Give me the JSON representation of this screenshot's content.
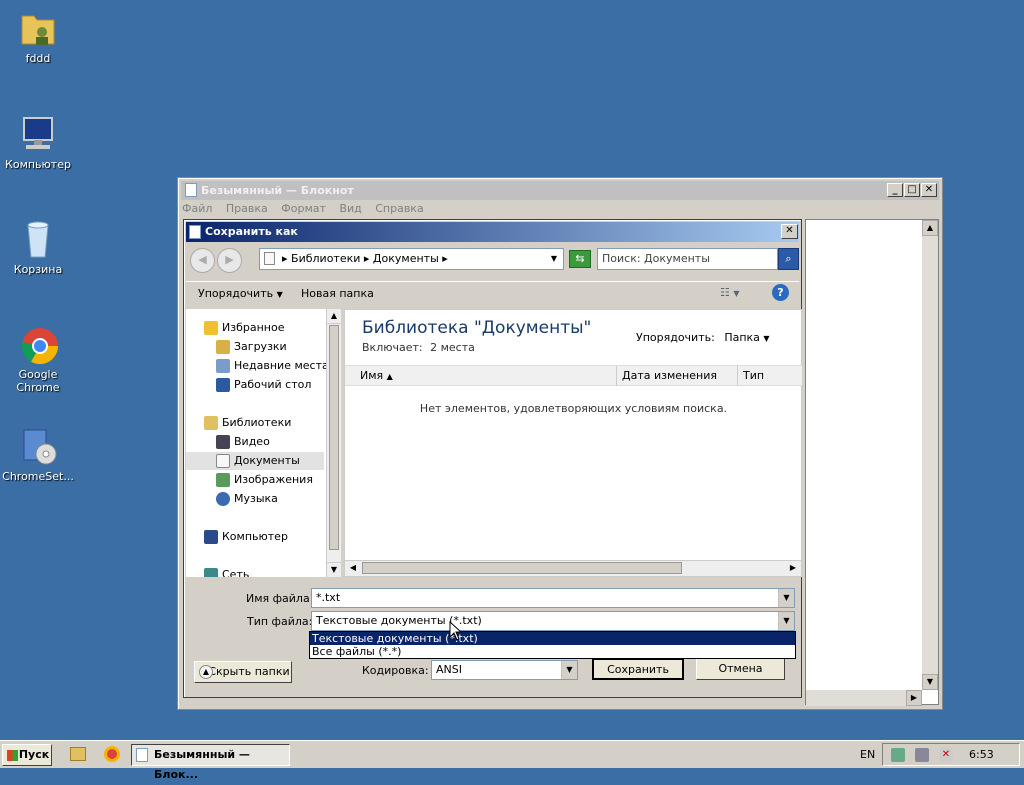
{
  "desktop": {
    "icons": [
      {
        "label": "fddd",
        "icon": "user-folder-icon"
      },
      {
        "label": "Компьютер",
        "icon": "computer-icon"
      },
      {
        "label": "Корзина",
        "icon": "recycle-bin-icon"
      },
      {
        "label": "Google Chrome",
        "icon": "chrome-icon"
      },
      {
        "label": "ChromeSet...",
        "icon": "setup-icon"
      }
    ]
  },
  "notepad": {
    "title": "Безымянный — Блокнот",
    "menu": [
      "Файл",
      "Правка",
      "Формат",
      "Вид",
      "Справка"
    ]
  },
  "dialog": {
    "title": "Сохранить как",
    "breadcrumb": [
      "Библиотеки",
      "Документы"
    ],
    "search_placeholder": "Поиск: Документы",
    "toolbar": {
      "organize": "Упорядочить",
      "new_folder": "Новая папка"
    },
    "nav": {
      "favorites": {
        "label": "Избранное",
        "items": [
          "Загрузки",
          "Недавние места",
          "Рабочий стол"
        ]
      },
      "libraries": {
        "label": "Библиотеки",
        "items": [
          "Видео",
          "Документы",
          "Изображения",
          "Музыка"
        ]
      },
      "computer": "Компьютер",
      "network": "Сеть"
    },
    "library": {
      "title": "Библиотека \"Документы\"",
      "includes_label": "Включает:",
      "includes_value": "2 места",
      "arrange_label": "Упорядочить:",
      "arrange_value": "Папка"
    },
    "columns": [
      "Имя",
      "Дата изменения",
      "Тип"
    ],
    "empty_message": "Нет элементов, удовлетворяющих условиям поиска.",
    "filename_label": "Имя файла:",
    "filename_value": "*.txt",
    "filetype_label": "Тип файла:",
    "filetype_value": "Текстовые документы (*.txt)",
    "filetype_options": [
      "Текстовые документы (*.txt)",
      "Все файлы  (*.*)"
    ],
    "hide_folders": "Скрыть папки",
    "encoding_label": "Кодировка:",
    "encoding_value": "ANSI",
    "save": "Сохранить",
    "cancel": "Отмена"
  },
  "taskbar": {
    "start": "Пуск",
    "task": "Безымянный — Блок...",
    "lang": "EN",
    "time": "6:53"
  }
}
